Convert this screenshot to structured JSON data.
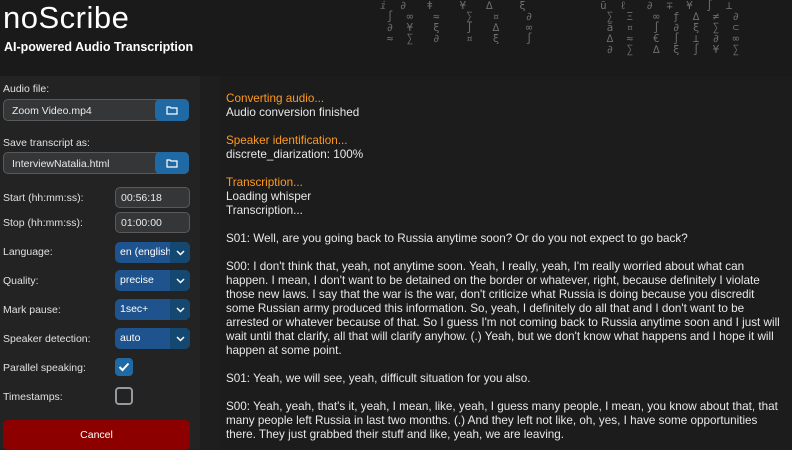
{
  "header": {
    "title": "noScribe",
    "subtitle": "AI-powered Audio Transcription"
  },
  "sidebar": {
    "audio_file_label": "Audio file:",
    "audio_file_value": "Zoom Video.mp4",
    "save_label": "Save transcript as:",
    "save_value": "InterviewNatalia.html",
    "start_label": "Start (hh:mm:ss):",
    "start_value": "00:56:18",
    "stop_label": "Stop (hh:mm:ss):",
    "stop_value": "01:00:00",
    "language_label": "Language:",
    "language_value": "en (english)",
    "quality_label": "Quality:",
    "quality_value": "precise",
    "mark_pause_label": "Mark pause:",
    "mark_pause_value": "1sec+",
    "speaker_detection_label": "Speaker detection:",
    "speaker_detection_value": "auto",
    "parallel_speaking_label": "Parallel speaking:",
    "parallel_speaking_checked": true,
    "timestamps_label": "Timestamps:",
    "timestamps_checked": false,
    "cancel_label": "Cancel"
  },
  "log": {
    "converting_heading": "Converting audio...",
    "converting_status": "Audio conversion finished",
    "speaker_heading": "Speaker identification...",
    "speaker_status": "discrete_diarization: 100%",
    "transcription_heading": "Transcription...",
    "transcription_line1": "Loading whisper",
    "transcription_line2": "Transcription...",
    "paragraphs": [
      "S01: Well, are you going back to Russia anytime soon? Or do you not expect to go back?",
      "S00: I don't think that, yeah, not anytime soon. Yeah, I really, yeah, I'm really worried about what can happen. I mean, I don't want to be detained on the border or whatever, right, because definitely I violate those new laws. I say that the war is the war, don't criticize what Russia is doing because you discredit some Russian army produced this information. So, yeah, I definitely do all that and I don't want to be arrested or whatever because of that. So I guess I'm not coming back to Russia anytime soon and I just will wait until that clarify, all that will clarify anyhow. (.) Yeah, but we don't know what happens and I hope it will happen at some point.",
      "S01: Yeah, we will see, yeah, difficult situation for you also.",
      "S00: Yeah, yeah, that's it, yeah, I mean, like, yeah, I guess many people, I mean, you know about that, that many people left Russia in last two months. (.) And they left not like, oh, yes, I have some opportunities there. They just grabbed their stuff and like, yeah, we are leaving."
    ]
  },
  "colors": {
    "accent_blue": "#1f6aa5",
    "dropdown_blue": "#1f538d",
    "cancel_red": "#8c0000",
    "heading_orange": "#ff9a1f"
  },
  "icons": {
    "browse": "folder-icon",
    "dropdown": "chevron-down-icon",
    "check": "checkmark-icon"
  }
}
